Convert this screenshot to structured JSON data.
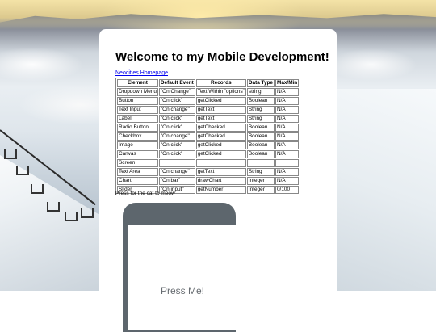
{
  "page": {
    "title": "Welcome to my Mobile Development!",
    "link_text": {
      "part1": "Neocities",
      "part2": "Homepage"
    }
  },
  "table": {
    "headers": [
      "Element",
      "Default Event",
      "Records",
      "Data Type",
      "Max/Min"
    ],
    "rows": [
      [
        "Dropdown Menu",
        "\"On Change\"",
        "Text Within \"options\"",
        "string",
        "N/A"
      ],
      [
        "Button",
        "\"On click\"",
        "getClicked",
        "Boolean",
        "N/A"
      ],
      [
        "Text Input",
        "\"On change\"",
        "getText",
        "String",
        "N/A"
      ],
      [
        "Label",
        "\"On click\"",
        "getText",
        "String",
        "N/A"
      ],
      [
        "Radio Button",
        "\"On click\"",
        "getChecked",
        "Boolean",
        "N/A"
      ],
      [
        "Checkbox",
        "\"On change\"",
        "getChecked",
        "Boolean",
        "N/A"
      ],
      [
        "Image",
        "\"On click\"",
        "getClicked",
        "Boolean",
        "N/A"
      ],
      [
        "Canvas",
        "\"On click\"",
        "getClicked",
        "Boolean",
        "N/A"
      ],
      [
        "Screen",
        "",
        "",
        "",
        ""
      ],
      [
        "Text Area",
        "\"On change\"",
        "getText",
        "String",
        "N/A"
      ],
      [
        "Chart",
        "\"On bar\"",
        "drawChart",
        "Integer",
        "N/A"
      ],
      [
        "Slider",
        "\"On input\"",
        "getNumber",
        "Integer",
        "0/100"
      ]
    ]
  },
  "cat_section": {
    "caption": "Press for the cat to meow",
    "button_label": "Press Me!",
    "button_color": "#5d666d"
  }
}
